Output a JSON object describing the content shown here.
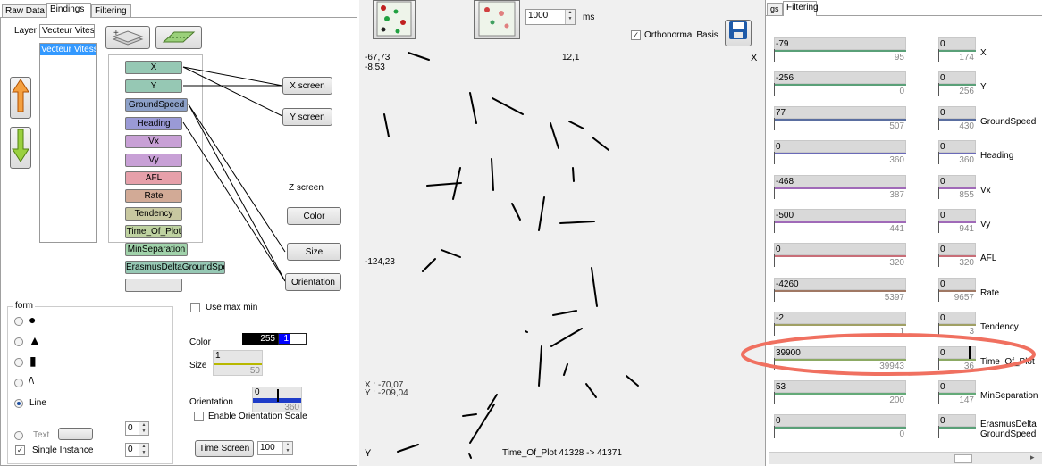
{
  "left_panel": {
    "tabs": [
      "Raw Data",
      "Bindings",
      "Filtering"
    ],
    "layer_label": "Layer",
    "layer_value": "Vecteur Vitess",
    "layer_list_item": "Vecteur Vitesse",
    "variables": [
      "X",
      "Y",
      "GroundSpeed",
      "Heading",
      "Vx",
      "Vy",
      "AFL",
      "Rate",
      "Tendency",
      "Time_Of_Plot",
      "MinSeparation",
      "ErasmusDeltaGroundSpeed",
      ""
    ],
    "var_colors": [
      "#96c8b4",
      "#96c8b4",
      "#8ca0c8",
      "#9a9ad6",
      "#c8a0d6",
      "#c8a0d6",
      "#e6a0aa",
      "#d2aa96",
      "#c8c8a0",
      "#bed2a0",
      "#a0d2aa",
      "#96c8b4",
      "#e6e6e6"
    ],
    "targets": {
      "xscreen": "X screen",
      "yscreen": "Y screen",
      "zscreen": "Z screen",
      "color": "Color",
      "size": "Size",
      "orientation": "Orientation"
    },
    "form_label": "form",
    "shapes": {
      "circle": "●",
      "triangle": "▲",
      "bar": "▮",
      "caret": "/\\",
      "line": "Line"
    },
    "use_max_min": "Use max min",
    "color_label": "Color",
    "color_value": "255",
    "color_value2": "1",
    "size_label": "Size",
    "size_value": "1",
    "size_max": "50",
    "orientation_label": "Orientation",
    "orientation_value": "0",
    "orientation_max": "360",
    "enable_orientation_scale": "Enable Orientation Scale",
    "text_label": "Text",
    "single_instance": "Single Instance",
    "spin1": "0",
    "spin2": "0",
    "time_screen": "Time Screen",
    "time_value": "100"
  },
  "center": {
    "interval_value": "1000",
    "interval_unit": "ms",
    "orthonormal": "Orthonormal Basis",
    "x_min": "-67,73",
    "x_mid": "12,1",
    "x_label": "X",
    "y_top": "-8,53",
    "y_mid": "-124,23",
    "y_label": "Y",
    "cursor_x": "X : -70,07",
    "cursor_y": "Y : -209,04",
    "footer": "Time_Of_Plot 41328 -> 41371"
  },
  "right_panel": {
    "tabs": [
      "gs",
      "Filtering"
    ],
    "filters": [
      {
        "name": "X",
        "v1": "-79",
        "m1": "95",
        "v2": "0",
        "m2": "174",
        "color": "#5aa078"
      },
      {
        "name": "Y",
        "v1": "-256",
        "m1": "0",
        "v2": "0",
        "m2": "256",
        "color": "#5aa078"
      },
      {
        "name": "GroundSpeed",
        "v1": "77",
        "m1": "507",
        "v2": "0",
        "m2": "430",
        "color": "#5a6ea0"
      },
      {
        "name": "Heading",
        "v1": "0",
        "m1": "360",
        "v2": "0",
        "m2": "360",
        "color": "#6a6ab8"
      },
      {
        "name": "Vx",
        "v1": "-468",
        "m1": "387",
        "v2": "0",
        "m2": "855",
        "color": "#a06ab8"
      },
      {
        "name": "Vy",
        "v1": "-500",
        "m1": "441",
        "v2": "0",
        "m2": "941",
        "color": "#a06ab8"
      },
      {
        "name": "AFL",
        "v1": "0",
        "m1": "320",
        "v2": "0",
        "m2": "320",
        "color": "#c86e78"
      },
      {
        "name": "Rate",
        "v1": "-4260",
        "m1": "5397",
        "v2": "0",
        "m2": "9657",
        "color": "#a07864"
      },
      {
        "name": "Tendency",
        "v1": "-2",
        "m1": "1",
        "v2": "0",
        "m2": "3",
        "color": "#a0a064"
      },
      {
        "name": "Time_Of_Plot",
        "v1": "39900",
        "m1": "39943",
        "v2": "0",
        "m2": "36",
        "color": "#8caa64"
      },
      {
        "name": "MinSeparation",
        "v1": "53",
        "m1": "200",
        "v2": "0",
        "m2": "147",
        "color": "#64aa78"
      },
      {
        "name": "ErasmusDeltaGroundSpeed",
        "v1": "0",
        "m1": "0",
        "v2": "0",
        "m2": "",
        "color": "#5aa078"
      }
    ],
    "highlight_color": "#f07060"
  }
}
